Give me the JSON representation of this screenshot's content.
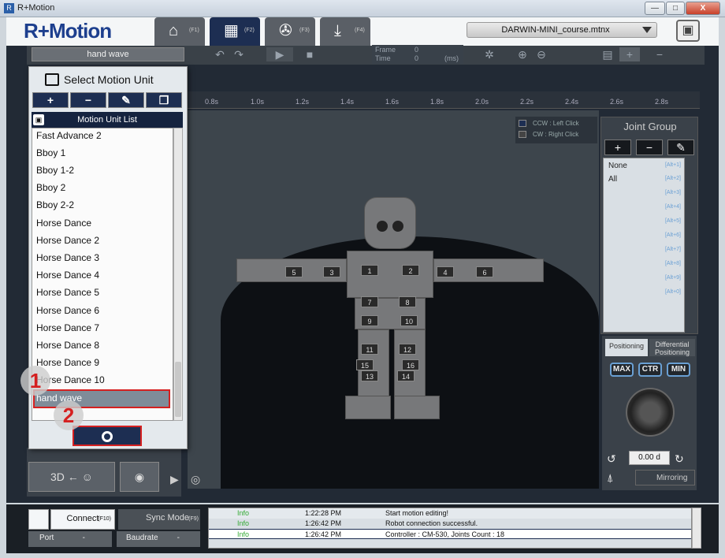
{
  "window": {
    "title": "R+Motion",
    "min": "—",
    "max": "□",
    "close": "X"
  },
  "app": {
    "logo": "R+Motion"
  },
  "tabs": [
    {
      "icon": "home-icon",
      "glyph": "⌂",
      "fkey": "(F1)"
    },
    {
      "icon": "film-icon",
      "glyph": "▦",
      "fkey": "(F2)"
    },
    {
      "icon": "film-reel-icon",
      "glyph": "✇",
      "fkey": "(F3)"
    },
    {
      "icon": "download-icon",
      "glyph": "⤓",
      "fkey": "(F4)"
    }
  ],
  "file": {
    "name": "DARWIN-MINI_course.mtnx"
  },
  "toolbar": {
    "motion": "hand wave",
    "frame_label": "Frame",
    "frame_value": "0",
    "time_label": "Time",
    "time_value": "0",
    "time_unit": "(ms)"
  },
  "timeline": {
    "ticks": [
      "0.8s",
      "1.0s",
      "1.2s",
      "1.4s",
      "1.6s",
      "1.8s",
      "2.0s",
      "2.2s",
      "2.4s",
      "2.6s",
      "2.8s"
    ]
  },
  "legend": {
    "ccw": "CCW : Left Click",
    "cw": "CW : Right Click"
  },
  "joints": [
    "1",
    "2",
    "3",
    "4",
    "5",
    "6",
    "7",
    "8",
    "9",
    "10",
    "11",
    "12",
    "13",
    "14",
    "15",
    "16"
  ],
  "joint_group": {
    "title": "Joint Group",
    "items": [
      "None",
      "All"
    ],
    "alt_labels": [
      "[Alt+1]",
      "[Alt+2]",
      "[Alt+3]",
      "[Alt+4]",
      "[Alt+5]",
      "[Alt+6]",
      "[Alt+7]",
      "[Alt+8]",
      "[Alt+9]",
      "[Alt+0]"
    ]
  },
  "positioning": {
    "tab1": "Positioning",
    "tab2": "Differential Positioning",
    "max": "MAX",
    "ctr": "CTR",
    "min": "MIN",
    "angle": "0.00 d",
    "mirroring": "Mirroring"
  },
  "popup": {
    "title": "Select Motion Unit",
    "list_header": "Motion Unit List",
    "items": [
      "Fast Advance 2",
      "Bboy 1",
      "Bboy 1-2",
      "Bboy 2",
      "Bboy 2-2",
      "Horse Dance",
      "Horse Dance 2",
      "Horse Dance 3",
      "Horse Dance 4",
      "Horse Dance 5",
      "Horse Dance 6",
      "Horse Dance 7",
      "Horse Dance 8",
      "Horse Dance 9",
      "Horse Dance 10",
      "hand wave"
    ],
    "selected": "hand wave",
    "badge1": "1",
    "badge2": "2"
  },
  "connection": {
    "connect": "Connect",
    "connect_key": "(F10)",
    "sync": "Sync Mode",
    "sync_key": "(F9)",
    "port": "Port",
    "baudrate": "Baudrate"
  },
  "log": [
    {
      "level": "Info",
      "time": "1:22:28 PM",
      "msg": "Start motion editing!"
    },
    {
      "level": "Info",
      "time": "1:26:42 PM",
      "msg": "Robot connection successful."
    },
    {
      "level": "Info",
      "time": "1:26:42 PM",
      "msg": "Controller : CM-530, Joints Count : 18"
    }
  ]
}
